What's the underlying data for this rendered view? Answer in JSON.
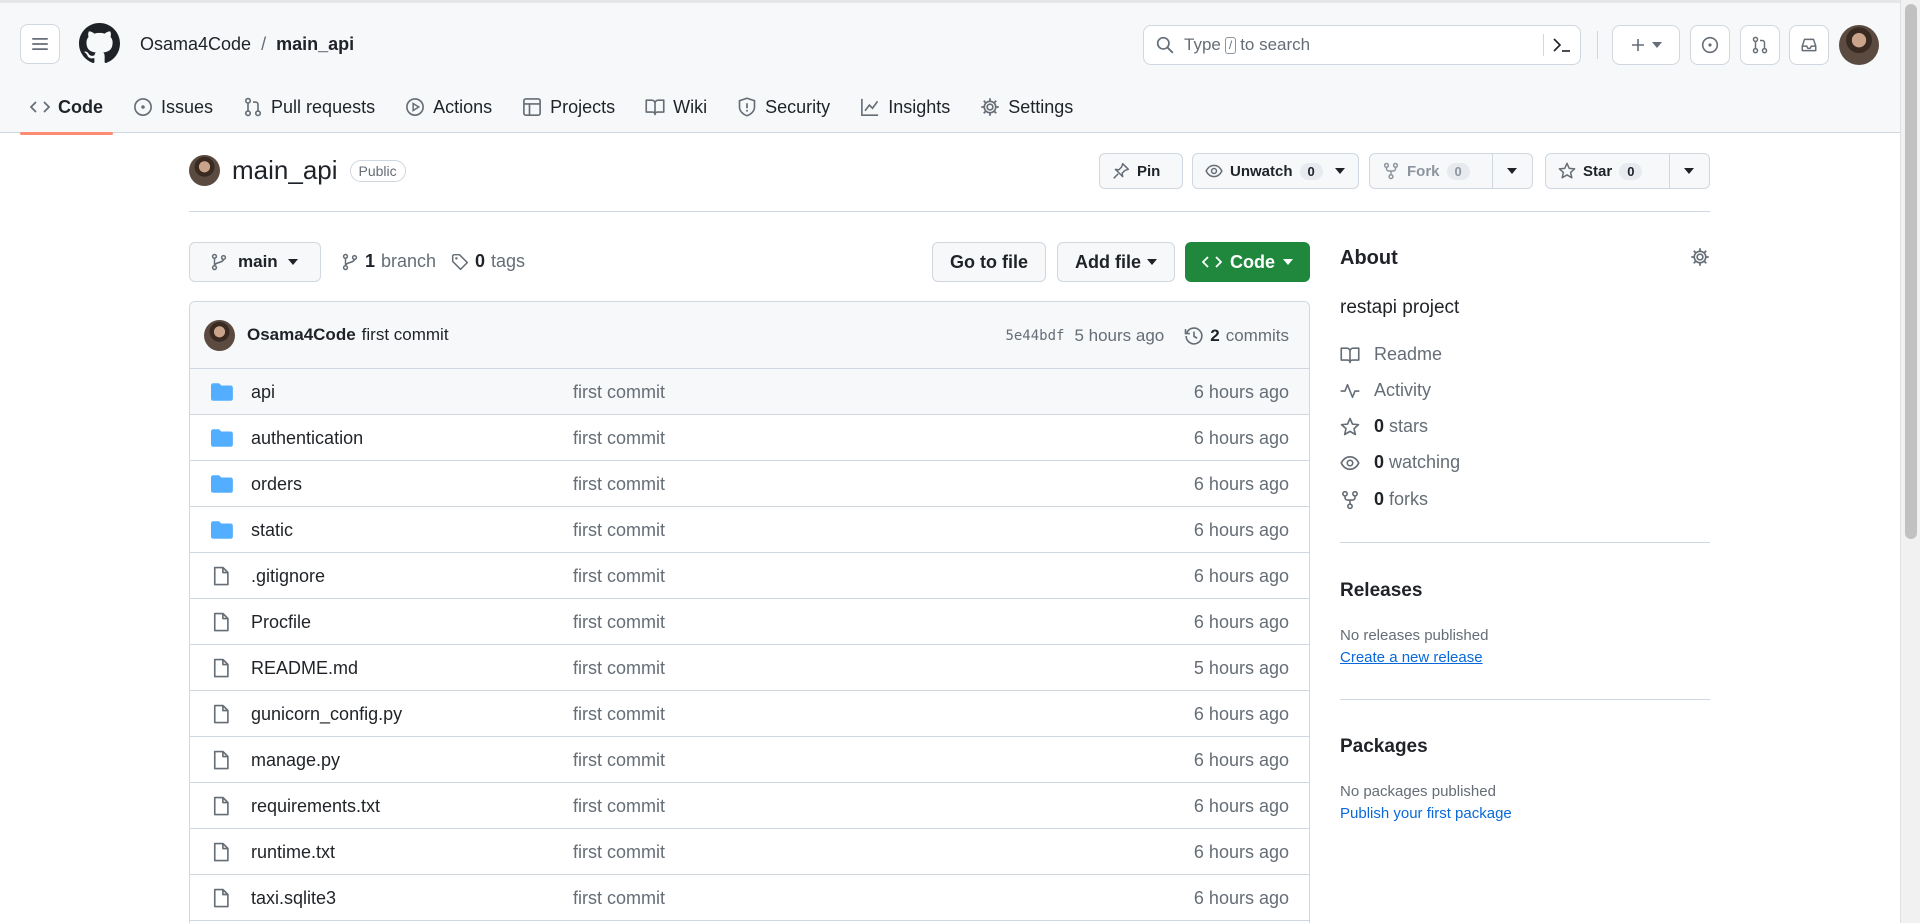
{
  "header": {
    "owner": "Osama4Code",
    "separator": "/",
    "repo": "main_api",
    "search_placeholder_pre": "Type",
    "search_key": "/",
    "search_placeholder_post": "to search"
  },
  "tabs": [
    {
      "label": "Code",
      "icon": "code-icon",
      "active": true
    },
    {
      "label": "Issues",
      "icon": "issue-icon"
    },
    {
      "label": "Pull requests",
      "icon": "pull-request-icon"
    },
    {
      "label": "Actions",
      "icon": "play-icon"
    },
    {
      "label": "Projects",
      "icon": "table-icon"
    },
    {
      "label": "Wiki",
      "icon": "book-icon"
    },
    {
      "label": "Security",
      "icon": "shield-icon"
    },
    {
      "label": "Insights",
      "icon": "graph-icon"
    },
    {
      "label": "Settings",
      "icon": "gear-icon"
    }
  ],
  "repo_header": {
    "name": "main_api",
    "visibility": "Public",
    "pin": "Pin",
    "unwatch": "Unwatch",
    "watch_count": "0",
    "fork": "Fork",
    "fork_count": "0",
    "star": "Star",
    "star_count": "0"
  },
  "branch_bar": {
    "branch": "main",
    "branch_count": "1",
    "branch_label": "branch",
    "tag_count": "0",
    "tag_label": "tags",
    "go_to_file": "Go to file",
    "add_file": "Add file",
    "code": "Code"
  },
  "latest_commit": {
    "author": "Osama4Code",
    "message": "first commit",
    "sha": "5e44bdf",
    "age": "5 hours ago",
    "commit_count": "2",
    "commits_label": "commits"
  },
  "files": [
    {
      "name": "api",
      "type": "dir",
      "message": "first commit",
      "age": "6 hours ago"
    },
    {
      "name": "authentication",
      "type": "dir",
      "message": "first commit",
      "age": "6 hours ago"
    },
    {
      "name": "orders",
      "type": "dir",
      "message": "first commit",
      "age": "6 hours ago"
    },
    {
      "name": "static",
      "type": "dir",
      "message": "first commit",
      "age": "6 hours ago"
    },
    {
      "name": ".gitignore",
      "type": "file",
      "message": "first commit",
      "age": "6 hours ago"
    },
    {
      "name": "Procfile",
      "type": "file",
      "message": "first commit",
      "age": "6 hours ago"
    },
    {
      "name": "README.md",
      "type": "file",
      "message": "first commit",
      "age": "5 hours ago"
    },
    {
      "name": "gunicorn_config.py",
      "type": "file",
      "message": "first commit",
      "age": "6 hours ago"
    },
    {
      "name": "manage.py",
      "type": "file",
      "message": "first commit",
      "age": "6 hours ago"
    },
    {
      "name": "requirements.txt",
      "type": "file",
      "message": "first commit",
      "age": "6 hours ago"
    },
    {
      "name": "runtime.txt",
      "type": "file",
      "message": "first commit",
      "age": "6 hours ago"
    },
    {
      "name": "taxi.sqlite3",
      "type": "file",
      "message": "first commit",
      "age": "6 hours ago"
    }
  ],
  "about": {
    "heading": "About",
    "description": "restapi project",
    "readme": "Readme",
    "activity": "Activity",
    "stars_count": "0",
    "stars_label": "stars",
    "watching_count": "0",
    "watching_label": "watching",
    "forks_count": "0",
    "forks_label": "forks"
  },
  "releases": {
    "heading": "Releases",
    "none": "No releases published",
    "create_link": "Create a new release"
  },
  "packages": {
    "heading": "Packages",
    "none": "No packages published",
    "publish_link": "Publish your first package"
  },
  "colors": {
    "primary_button": "#1f883d",
    "link": "#0969da",
    "active_tab_underline": "#fd8c73",
    "folder": "#54aeff"
  }
}
